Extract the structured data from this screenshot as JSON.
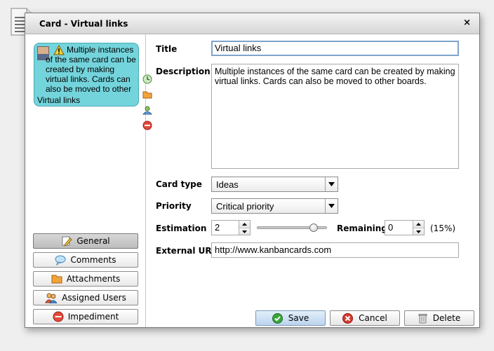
{
  "dialog": {
    "title": "Card  - Virtual links",
    "close_label": "×"
  },
  "card_preview": {
    "description": "Multiple instances of the same card can be created by making virtual links. Cards can also be moved to other boards.",
    "title": "Virtual links"
  },
  "nav": {
    "general": "General",
    "comments": "Comments",
    "attachments": "Attachments",
    "assigned_users": "Assigned Users",
    "impediment": "Impediment"
  },
  "form": {
    "title_label": "Title",
    "title_value": "Virtual links",
    "description_label": "Description",
    "description_value": "Multiple instances of the same card can be created by making virtual links. Cards can also be moved to other boards.",
    "card_type_label": "Card type",
    "card_type_value": "Ideas",
    "priority_label": "Priority",
    "priority_value": "Critical priority",
    "estimation_label": "Estimation",
    "estimation_value": "2",
    "remaining_label": "Remaining",
    "remaining_value": "0",
    "remaining_percent": "(15%)",
    "slider_fraction": 0.82,
    "external_url_label": "External URL",
    "external_url_value": "http://www.kanbancards.com"
  },
  "actions": {
    "save": "Save",
    "cancel": "Cancel",
    "delete": "Delete"
  },
  "colors": {
    "card_background": "#74d4dc",
    "save_accent": "#3aa53a",
    "cancel_accent": "#d83a2e"
  }
}
